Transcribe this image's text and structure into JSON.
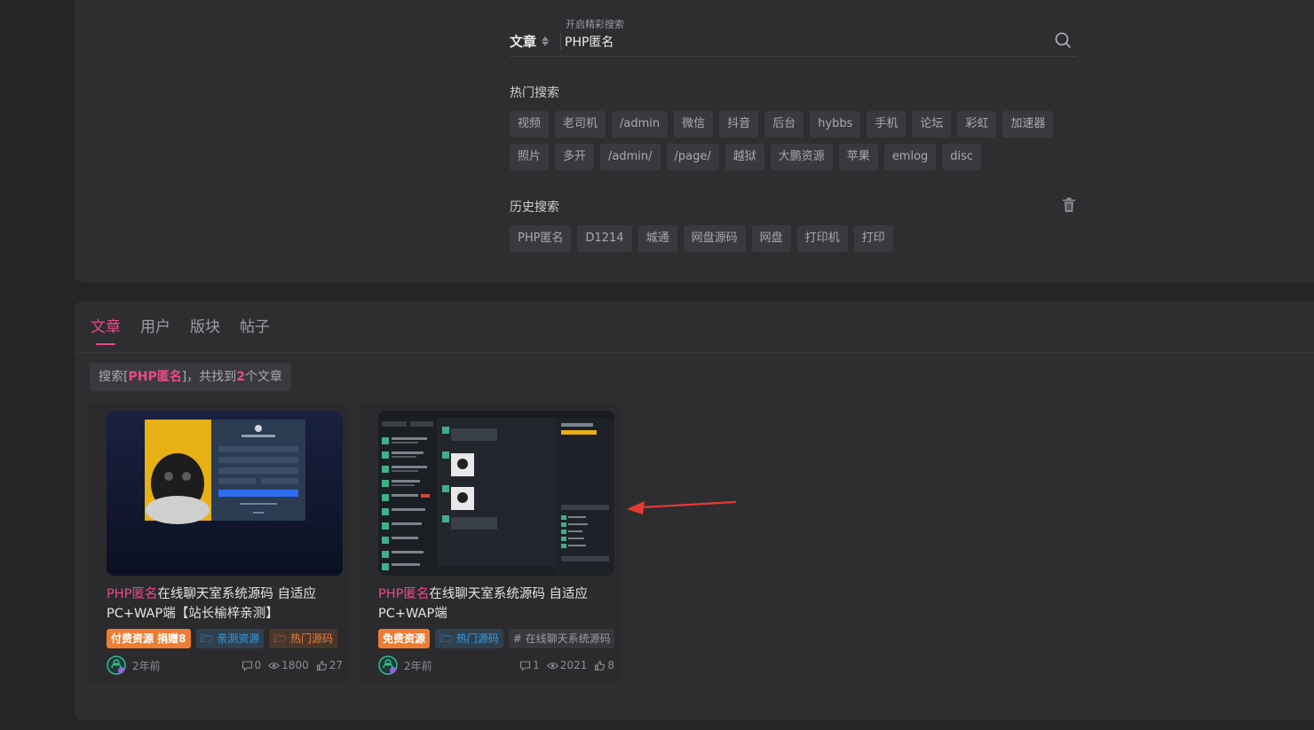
{
  "search": {
    "type_label": "文章",
    "float_label": "开启精彩搜索",
    "query": "PHP匿名"
  },
  "hot": {
    "title": "热门搜索",
    "tags": [
      "视频",
      "老司机",
      "/admin",
      "微信",
      "抖音",
      "后台",
      "hybbs",
      "手机",
      "论坛",
      "彩虹",
      "加速器",
      "照片",
      "多开",
      "/admin/",
      "/page/",
      "越狱",
      "大鹏资源",
      "苹果",
      "emlog",
      "disc"
    ]
  },
  "history": {
    "title": "历史搜索",
    "tags": [
      "PHP匿名",
      "D1214",
      "城通",
      "网盘源码",
      "网盘",
      "打印机",
      "打印"
    ]
  },
  "tabs": [
    "文章",
    "用户",
    "版块",
    "帖子"
  ],
  "summary": {
    "prefix": "搜索[",
    "keyword": "PHP匿名",
    "middle": "]，共找到",
    "count": "2",
    "suffix": "个文章"
  },
  "cards": [
    {
      "title_hl": "PHP匿名",
      "title_rest": "在线聊天室系统源码 自适应PC+WAP端【站长榆梓亲测】",
      "tags": [
        "付费资源 捐赠8",
        "亲测资源",
        "热门源码"
      ],
      "time": "2年前",
      "comments": "0",
      "views": "1800",
      "likes": "27"
    },
    {
      "title_hl": "PHP匿名",
      "title_rest": "在线聊天室系统源码 自适应PC+WAP端",
      "tags": [
        "免费资源",
        "热门源码",
        "# 在线聊天系统源码"
      ],
      "time": "2年前",
      "comments": "1",
      "views": "2021",
      "likes": "8"
    }
  ],
  "colors": {
    "accent": "#ea4a8a",
    "tag_orange": "#ee7d33",
    "tag_blue": "#3d9be0"
  }
}
